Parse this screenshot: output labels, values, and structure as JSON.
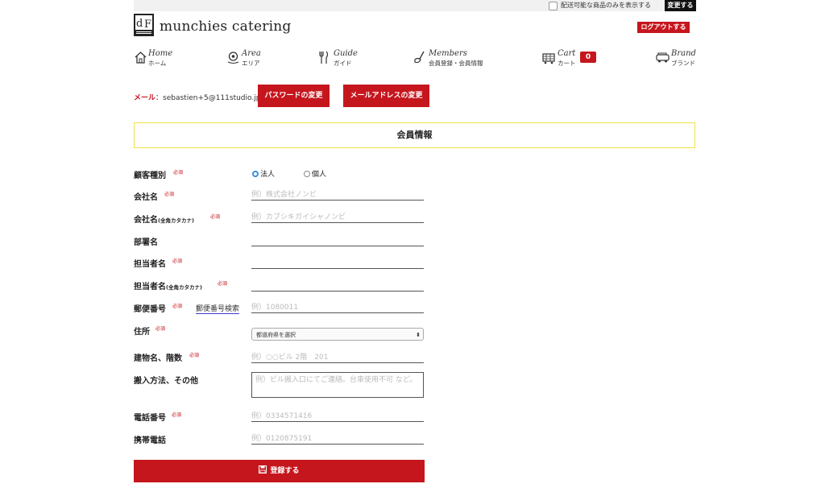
{
  "topbar": {
    "delivery_filter_label": "配送可能な商品のみを表示する",
    "change_button": "変更する"
  },
  "header": {
    "logo_alt": "dF munchies Tokyo",
    "brand_name": "munchies catering",
    "logout_button": "ログアウトする"
  },
  "nav": [
    {
      "en": "Home",
      "jp": "ホーム",
      "icon": "home-icon"
    },
    {
      "en": "Area",
      "jp": "エリア",
      "icon": "map-pin-icon"
    },
    {
      "en": "Guide",
      "jp": "ガイド",
      "icon": "utensils-icon"
    },
    {
      "en": "Members",
      "jp": "会員登録・会員情報",
      "icon": "ladle-icon"
    },
    {
      "en": "Cart",
      "jp": "カート",
      "icon": "cart-icon",
      "count": "0"
    },
    {
      "en": "Brand",
      "jp": "ブランド",
      "icon": "truck-icon"
    }
  ],
  "account": {
    "email_key": "メール",
    "email_sep": "：",
    "email_value": "sebastien+5@111studio.jp",
    "change_password_button": "パスワードの変更",
    "change_email_button": "メールアドレスの変更"
  },
  "section_title": "会員情報",
  "required_mark": "必須",
  "form": {
    "customer_type": {
      "label": "顧客種別",
      "options": [
        "法人",
        "個人"
      ],
      "selected": "法人"
    },
    "company_name": {
      "label": "会社名",
      "placeholder": "例）株式会社ノンビ"
    },
    "company_kana": {
      "label": "会社名",
      "note": "(全角カタカナ)",
      "placeholder": "例）カブシキガイシャノンビ"
    },
    "department": {
      "label": "部署名",
      "placeholder": ""
    },
    "contact_name": {
      "label": "担当者名",
      "placeholder": ""
    },
    "contact_kana": {
      "label": "担当者名",
      "note": "(全角カタカナ)",
      "placeholder": ""
    },
    "postal_code": {
      "label": "郵便番号",
      "placeholder": "例）1080011",
      "search_link": "郵便番号検索"
    },
    "address": {
      "label": "住所",
      "select_value": "都道府県を選択"
    },
    "building": {
      "label": "建物名、階数",
      "placeholder": "例）○○ビル 2階　201"
    },
    "delivery_method": {
      "label": "搬入方法、その他",
      "placeholder": "例）ビル搬入口にてご連絡。台車使用不可 など。"
    },
    "phone": {
      "label": "電話番号",
      "placeholder": "例）0334571416"
    },
    "mobile": {
      "label": "携帯電話",
      "placeholder": "例）0120875191"
    }
  },
  "submit_button": "登録する",
  "colors": {
    "accent": "#c6161d",
    "section_border": "#f0e04a",
    "radio": "#3a8ee6"
  }
}
